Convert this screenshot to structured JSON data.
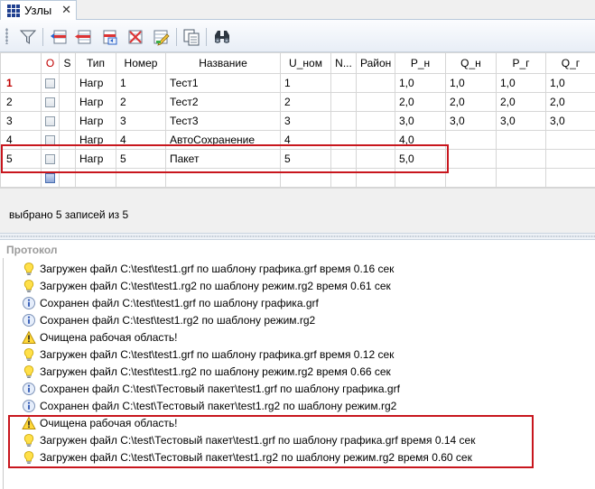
{
  "tab": {
    "label": "Узлы",
    "close": "✕",
    "icon": "grid-icon"
  },
  "toolbar": {
    "buttons": [
      {
        "name": "filter-button",
        "icon": "funnel-icon"
      },
      {
        "name": "add-row-button",
        "icon": "add-row-icon"
      },
      {
        "name": "delete-row-button",
        "icon": "delete-row-icon"
      },
      {
        "name": "copy-row-button",
        "icon": "copy-row-icon"
      },
      {
        "name": "cut-row-button",
        "icon": "cut-row-icon"
      },
      {
        "name": "edit-row-button",
        "icon": "edit-row-icon"
      },
      {
        "name": "copy-table-button",
        "icon": "copy-table-icon"
      },
      {
        "name": "find-button",
        "icon": "binoculars-icon"
      }
    ]
  },
  "grid": {
    "columns": [
      "",
      "O",
      "S",
      "Тип",
      "Номер",
      "Название",
      "U_ном",
      "N...",
      "Район",
      "P_н",
      "Q_н",
      "P_г",
      "Q_г"
    ],
    "rows": [
      {
        "num": "1",
        "tip": "Нагр",
        "nomer": "1",
        "name": "Тест1",
        "unom": "1",
        "n": "",
        "rayon": "",
        "pn": "1,0",
        "qn": "1,0",
        "pg": "1,0",
        "qg": "1,0"
      },
      {
        "num": "2",
        "tip": "Нагр",
        "nomer": "2",
        "name": "Тест2",
        "unom": "2",
        "n": "",
        "rayon": "",
        "pn": "2,0",
        "qn": "2,0",
        "pg": "2,0",
        "qg": "2,0"
      },
      {
        "num": "3",
        "tip": "Нагр",
        "nomer": "3",
        "name": "Тест3",
        "unom": "3",
        "n": "",
        "rayon": "",
        "pn": "3,0",
        "qn": "3,0",
        "pg": "3,0",
        "qg": "3,0"
      },
      {
        "num": "4",
        "tip": "Нагр",
        "nomer": "4",
        "name": "АвтоСохранение",
        "unom": "4",
        "n": "",
        "rayon": "",
        "pn": "4,0",
        "qn": "",
        "pg": "",
        "qg": ""
      },
      {
        "num": "5",
        "tip": "Нагр",
        "nomer": "5",
        "name": "Пакет",
        "unom": "5",
        "n": "",
        "rayon": "",
        "pn": "5,0",
        "qn": "",
        "pg": "",
        "qg": ""
      }
    ],
    "status": "выбрано 5 записей из 5"
  },
  "protocol": {
    "title": "Протокол",
    "entries": [
      {
        "type": "bulb",
        "text": "Загружен файл C:\\test\\test1.grf по шаблону графика.grf время 0.16 сек"
      },
      {
        "type": "bulb",
        "text": "Загружен файл C:\\test\\test1.rg2 по шаблону режим.rg2 время 0.61 сек"
      },
      {
        "type": "info",
        "text": "Сохранен файл C:\\test\\test1.grf по шаблону графика.grf"
      },
      {
        "type": "info",
        "text": "Сохранен файл C:\\test\\test1.rg2 по шаблону режим.rg2"
      },
      {
        "type": "warning",
        "text": "Очищена рабочая область!"
      },
      {
        "type": "bulb",
        "text": "Загружен файл C:\\test\\test1.grf по шаблону графика.grf время 0.12 сек"
      },
      {
        "type": "bulb",
        "text": "Загружен файл C:\\test\\test1.rg2 по шаблону режим.rg2 время 0.66 сек"
      },
      {
        "type": "info",
        "text": "Сохранен файл C:\\test\\Тестовый пакет\\test1.grf по шаблону графика.grf"
      },
      {
        "type": "info",
        "text": "Сохранен файл C:\\test\\Тестовый пакет\\test1.rg2 по шаблону режим.rg2"
      },
      {
        "type": "warning",
        "text": "Очищена рабочая область!"
      },
      {
        "type": "bulb",
        "text": "Загружен файл C:\\test\\Тестовый пакет\\test1.grf по шаблону графика.grf время 0.14 сек"
      },
      {
        "type": "bulb",
        "text": "Загружен файл C:\\test\\Тестовый пакет\\test1.rg2 по шаблону режим.rg2 время 0.60 сек"
      }
    ]
  },
  "colors": {
    "highlight": "#c8161d",
    "row_number_red": "#c00000",
    "accent": "#1f3f8f"
  }
}
